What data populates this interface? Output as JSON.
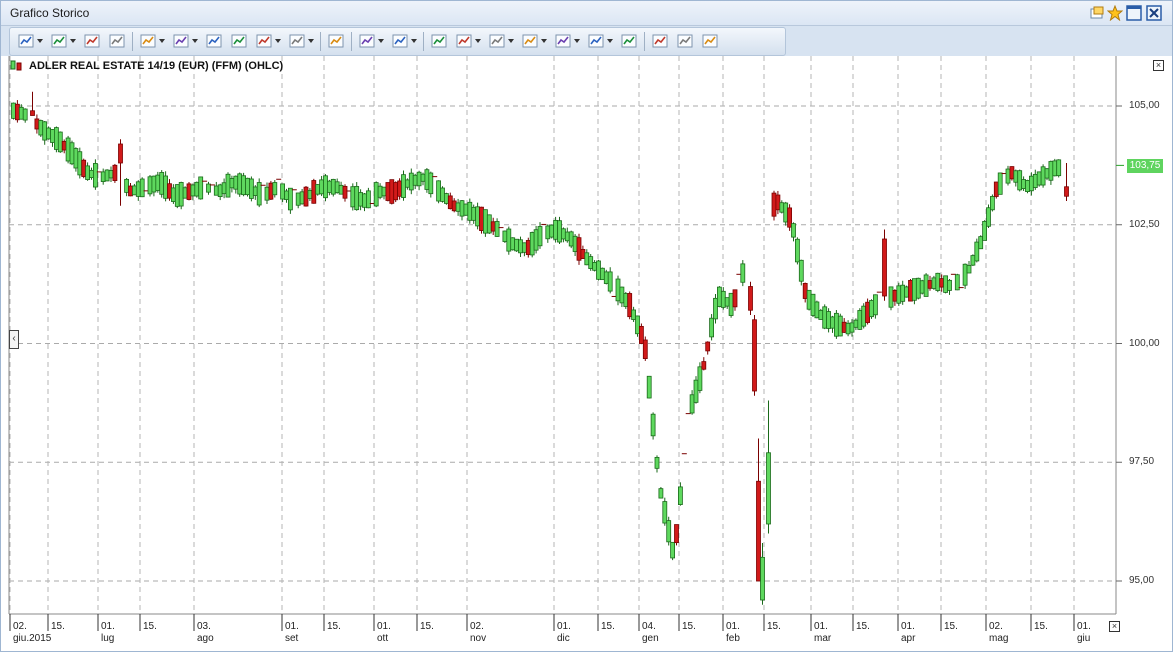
{
  "window": {
    "title": "Grafico Storico"
  },
  "toolbar": {
    "buttons": [
      {
        "name": "chart-type-icon",
        "dd": true
      },
      {
        "name": "add-indicator-icon",
        "dd": true
      },
      {
        "name": "crosshair-plus-icon",
        "dd": false
      },
      {
        "name": "compare-icon",
        "dd": false
      },
      {
        "name": "line-indicator-icon",
        "dd": true
      },
      {
        "name": "drawing-tools-icon",
        "dd": true
      },
      {
        "name": "volume-bars-icon",
        "dd": false
      },
      {
        "name": "trend-icon",
        "dd": false
      },
      {
        "name": "candlestick-icon",
        "dd": true
      },
      {
        "name": "currency-icon",
        "dd": true
      },
      {
        "name": "scale-icon",
        "dd": false
      },
      {
        "name": "line-style-icon",
        "dd": true
      },
      {
        "name": "grid-icon",
        "dd": true
      },
      {
        "name": "remove-drawing-icon",
        "dd": false
      },
      {
        "name": "zoom-icon",
        "dd": true
      },
      {
        "name": "pointer-icon",
        "dd": true
      },
      {
        "name": "pen-icon",
        "dd": true
      },
      {
        "name": "color-icon",
        "dd": true
      },
      {
        "name": "settings-icon",
        "dd": true
      },
      {
        "name": "delete-icon",
        "dd": false
      },
      {
        "name": "clipboard-icon",
        "dd": false
      },
      {
        "name": "print-icon",
        "dd": false
      },
      {
        "name": "export-icon",
        "dd": false
      }
    ]
  },
  "chart_data": {
    "type": "ohlc",
    "title": "ADLER REAL ESTATE  14/19 (EUR) (FFM) (OHLC)",
    "y_ticks": [
      "105,00",
      "102,50",
      "100,00",
      "97,50",
      "95,00"
    ],
    "y_tick_values": [
      105.0,
      102.5,
      100.0,
      97.5,
      95.0
    ],
    "ylim": [
      94.4,
      106.0
    ],
    "last_price": "103,75",
    "last_price_value": 103.75,
    "x_ticks": [
      {
        "day": "02.",
        "month": "giu.2015"
      },
      {
        "day": "15.",
        "month": ""
      },
      {
        "day": "01.",
        "month": "lug"
      },
      {
        "day": "15.",
        "month": ""
      },
      {
        "day": "03.",
        "month": "ago"
      },
      {
        "day": "01.",
        "month": "set"
      },
      {
        "day": "15.",
        "month": ""
      },
      {
        "day": "01.",
        "month": "ott"
      },
      {
        "day": "15.",
        "month": ""
      },
      {
        "day": "02.",
        "month": "nov"
      },
      {
        "day": "01.",
        "month": "dic"
      },
      {
        "day": "15.",
        "month": ""
      },
      {
        "day": "04.",
        "month": "gen"
      },
      {
        "day": "15.",
        "month": ""
      },
      {
        "day": "01.",
        "month": "feb"
      },
      {
        "day": "15.",
        "month": ""
      },
      {
        "day": "01.",
        "month": "mar"
      },
      {
        "day": "15.",
        "month": ""
      },
      {
        "day": "01.",
        "month": "apr"
      },
      {
        "day": "15.",
        "month": ""
      },
      {
        "day": "02.",
        "month": "mag"
      },
      {
        "day": "15.",
        "month": ""
      },
      {
        "day": "01.",
        "month": "giu"
      }
    ],
    "anchor_prices": [
      104.9,
      104.8,
      104.5,
      104.3,
      104.0,
      103.6,
      103.5,
      103.6,
      103.2,
      103.3,
      103.4,
      103.1,
      103.2,
      103.3,
      103.2,
      103.4,
      103.3,
      103.1,
      103.3,
      103.0,
      103.1,
      103.3,
      103.3,
      103.1,
      103.0,
      103.2,
      103.2,
      103.4,
      103.5,
      103.2,
      102.9,
      102.8,
      102.6,
      102.4,
      102.1,
      102.0,
      102.3,
      102.4,
      102.2,
      101.8,
      101.5,
      101.2,
      100.8,
      100.0,
      97.0,
      95.5,
      98.5,
      99.5,
      101.0,
      100.8,
      101.8,
      102.6,
      103.0,
      102.6,
      101.0,
      100.6,
      100.4,
      100.3,
      100.6,
      100.9,
      101.0,
      101.1,
      101.2,
      101.3,
      101.2,
      101.5,
      102.2,
      103.3,
      103.6,
      103.3,
      103.5,
      103.7,
      103.7
    ],
    "special_bars": [
      {
        "x": 757,
        "open": 97.1,
        "close": 95.0,
        "high": 98.0,
        "low": 95.0,
        "color": "red"
      },
      {
        "x": 761,
        "open": 95.5,
        "close": 94.6,
        "high": 95.8,
        "low": 94.5,
        "color": "green"
      },
      {
        "x": 767,
        "open": 96.2,
        "close": 97.7,
        "high": 98.8,
        "low": 96.0,
        "color": "green"
      },
      {
        "x": 749,
        "open": 101.2,
        "close": 100.7,
        "high": 101.3,
        "low": 100.6,
        "color": "red"
      },
      {
        "x": 753,
        "open": 100.5,
        "close": 99.0,
        "high": 100.6,
        "low": 98.9,
        "color": "red"
      },
      {
        "x": 883,
        "open": 102.2,
        "close": 101.0,
        "high": 102.4,
        "low": 100.9,
        "color": "red"
      },
      {
        "x": 119,
        "open": 104.2,
        "close": 103.8,
        "high": 104.3,
        "low": 102.9,
        "color": "red"
      },
      {
        "x": 1065,
        "open": 103.3,
        "close": 103.1,
        "high": 103.8,
        "low": 103.0,
        "color": "red"
      },
      {
        "x": 31,
        "open": 104.9,
        "close": 104.8,
        "high": 105.3,
        "low": 104.8,
        "color": "red"
      }
    ]
  }
}
